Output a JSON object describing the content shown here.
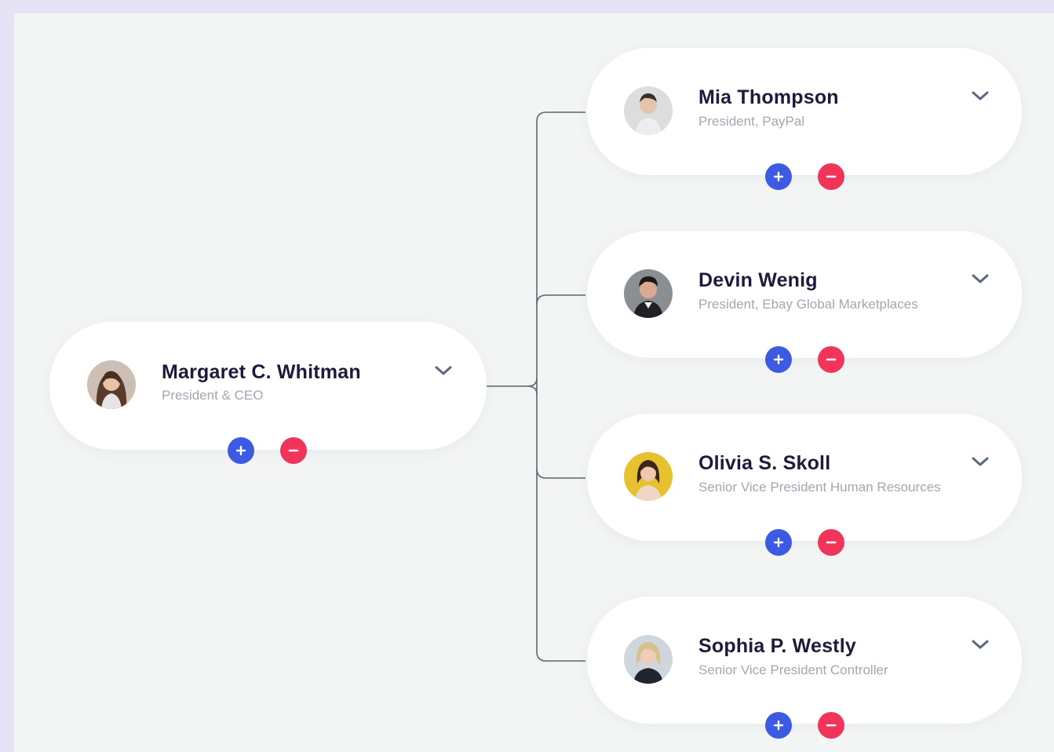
{
  "root": {
    "name": "Margaret C. Whitman",
    "title": "President & CEO",
    "avatar": "woman-brown-hair-avatar"
  },
  "reports": [
    {
      "name": "Mia Thompson",
      "title": "President, PayPal",
      "avatar": "man-light-shirt-avatar"
    },
    {
      "name": "Devin Wenig",
      "title": "President, Ebay Global Marketplaces",
      "avatar": "man-dark-hair-avatar"
    },
    {
      "name": "Olivia S. Skoll",
      "title": "Senior Vice President Human Resources",
      "avatar": "woman-yellow-background-avatar"
    },
    {
      "name": "Sophia P. Westly",
      "title": "Senior Vice President Controller",
      "avatar": "woman-blonde-hair-avatar"
    }
  ],
  "icons": {
    "expand": "chevron-down-icon",
    "add": "plus-icon",
    "remove": "minus-icon"
  },
  "colors": {
    "add_button": "#3d5ae3",
    "remove_button": "#f0345a",
    "connector": "#5b6677",
    "name_text": "#1d1b3c",
    "title_text": "#a3a6b3",
    "canvas": "#f3f5f5",
    "frame": "#e6e3f6"
  }
}
